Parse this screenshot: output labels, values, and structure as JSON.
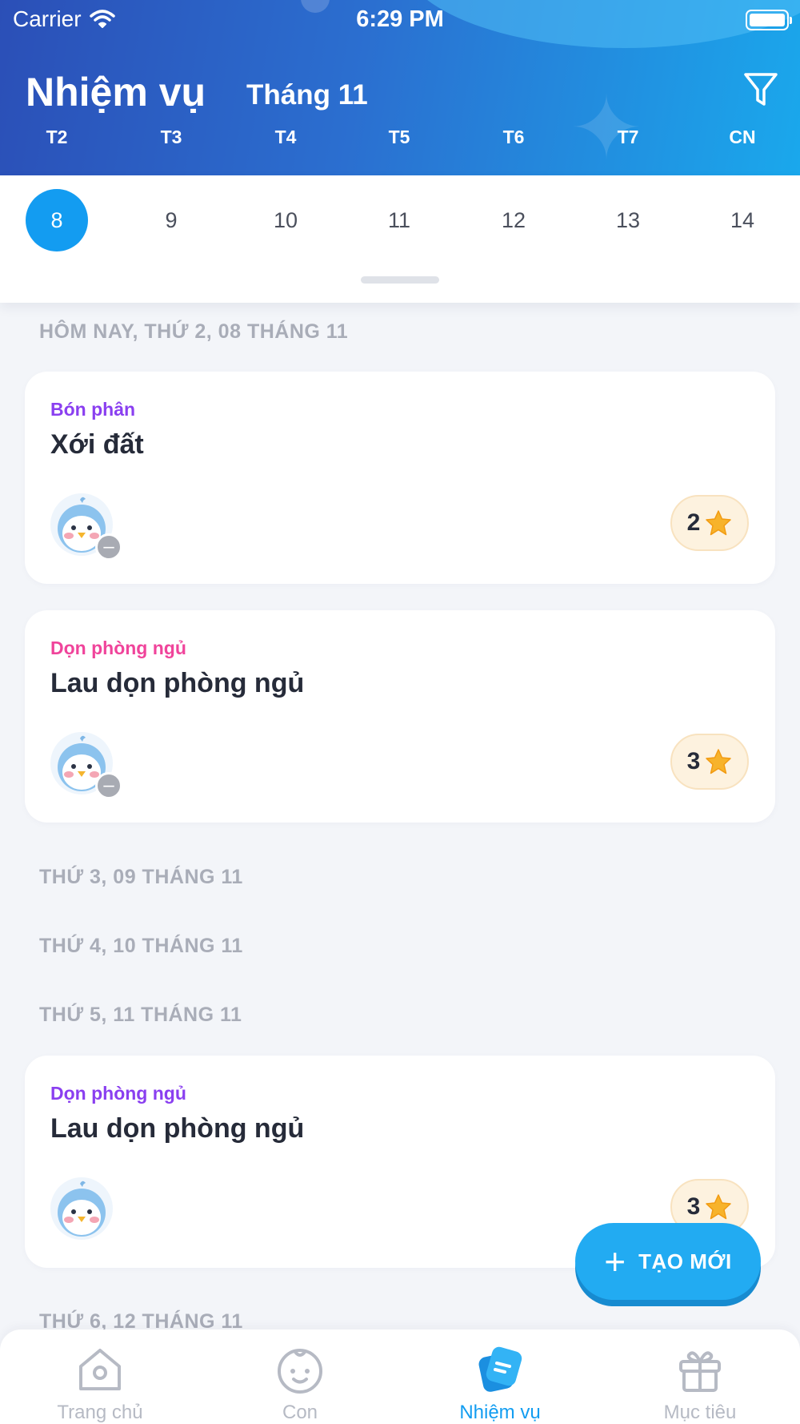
{
  "status_bar": {
    "carrier": "Carrier",
    "time": "6:29 PM"
  },
  "header": {
    "title": "Nhiệm vụ",
    "month": "Tháng 11",
    "weekdays": [
      "T2",
      "T3",
      "T4",
      "T5",
      "T6",
      "T7",
      "CN"
    ]
  },
  "dates": {
    "days": [
      "8",
      "9",
      "10",
      "11",
      "12",
      "13",
      "14"
    ],
    "selected": "8"
  },
  "sections": [
    {
      "label": "HÔM NAY, THỨ 2, 08 THÁNG 11",
      "tasks": [
        {
          "category": "Bón phân",
          "category_color": "#8a3ff0",
          "title": "Xới đất",
          "stars": "2",
          "status": "minus"
        },
        {
          "category": "Dọn phòng ngủ",
          "category_color": "#f0449b",
          "title": "Lau dọn phòng ngủ",
          "stars": "3",
          "status": "minus"
        }
      ]
    },
    {
      "label": "THỨ 3, 09 THÁNG 11",
      "tasks": []
    },
    {
      "label": "THỨ 4, 10 THÁNG 11",
      "tasks": []
    },
    {
      "label": "THỨ 5, 11 THÁNG 11",
      "tasks": [
        {
          "category": "Dọn phòng ngủ",
          "category_color": "#8a3ff0",
          "title": "Lau dọn phòng ngủ",
          "stars": "3",
          "status": "none"
        }
      ]
    },
    {
      "label": "THỨ 6, 12 THÁNG 11",
      "tasks": []
    }
  ],
  "fab": {
    "label": "TẠO MỚI",
    "icon": "plus-icon"
  },
  "tabs": [
    {
      "label": "Trang chủ",
      "icon": "home-icon",
      "active": false
    },
    {
      "label": "Con",
      "icon": "child-face-icon",
      "active": false
    },
    {
      "label": "Nhiệm vụ",
      "icon": "tasks-icon",
      "active": true
    },
    {
      "label": "Mục tiêu",
      "icon": "gift-icon",
      "active": false
    }
  ],
  "colors": {
    "accent": "#139cf1",
    "header_start": "#2b4fb7",
    "header_end": "#1aa8ec",
    "star": "#f7b32b"
  }
}
